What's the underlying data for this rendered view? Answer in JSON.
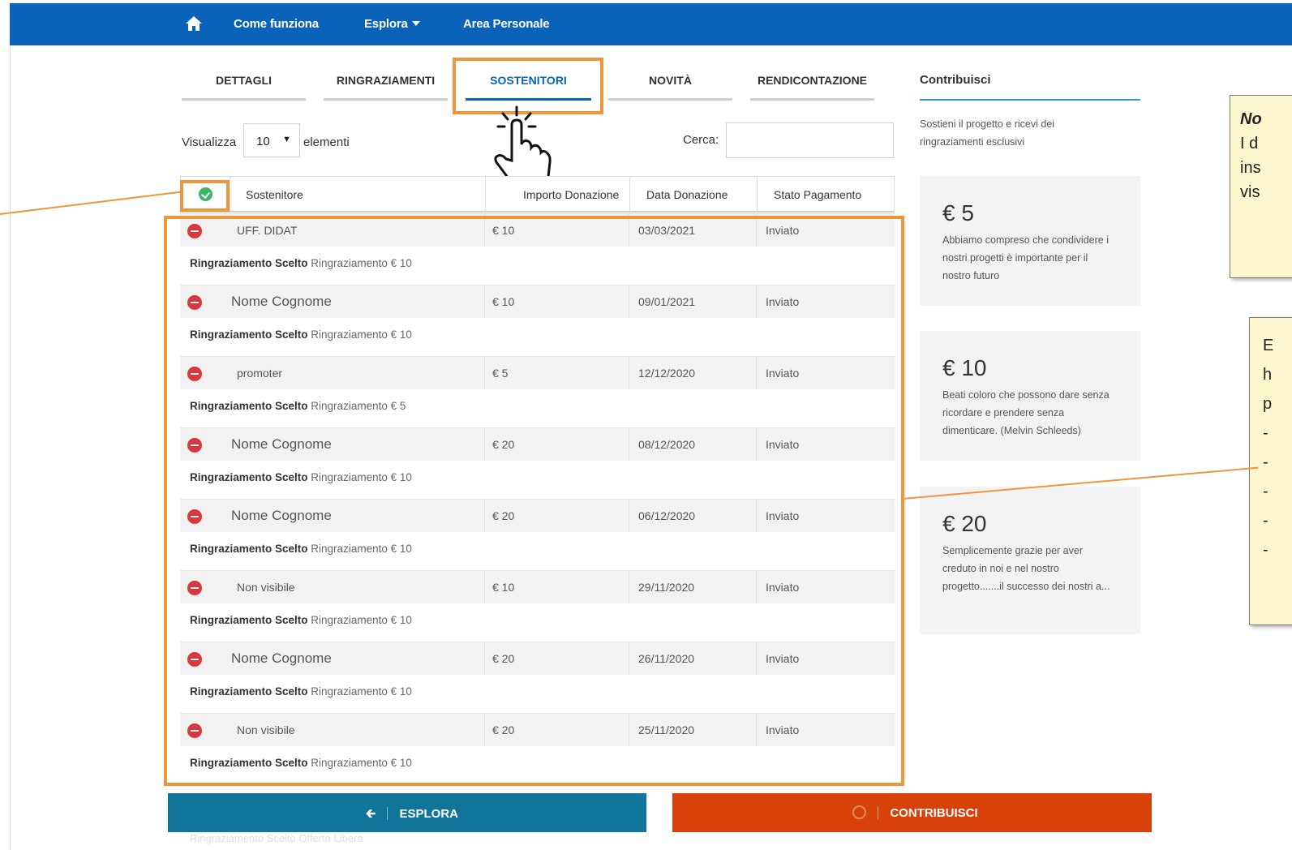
{
  "nav": {
    "items": [
      "Come funziona",
      "Esplora",
      "Area Personale"
    ]
  },
  "tabs": [
    "DETTAGLI",
    "RINGRAZIAMENTI",
    "SOSTENITORI",
    "NOVITÀ",
    "RENDICONTAZIONE"
  ],
  "active_tab": "SOSTENITORI",
  "sidebar": {
    "title": "Contribuisci",
    "subtitle": "Sostieni il progetto e ricevi dei ringraziamenti esclusivi",
    "rewards": [
      {
        "amount": "€ 5",
        "text": "Abbiamo compreso che condividere i nostri progetti è importante per il nostro futuro"
      },
      {
        "amount": "€ 10",
        "text": "Beati coloro che possono dare senza ricordare e prendere senza dimenticare. (Melvin Schleeds)"
      },
      {
        "amount": "€ 20",
        "text": "Semplicemente grazie per aver creduto in noi e nel nostro progetto.......il successo dei nostri a..."
      }
    ]
  },
  "controls": {
    "show_label": "Visualizza",
    "show_value": "10",
    "show_after": "elementi",
    "search_label": "Cerca:"
  },
  "table": {
    "headers": [
      "Sostenitore",
      "Importo Donazione",
      "Data Donazione",
      "Stato Pagamento"
    ],
    "reward_label": "Ringraziamento Scelto",
    "rows": [
      {
        "name": "UFF. DIDAT",
        "amount": "€ 10",
        "date": "03/03/2021",
        "status": "Inviato",
        "reward": "Ringraziamento € 10",
        "big": false
      },
      {
        "name": "Nome Cognome",
        "amount": "€ 10",
        "date": "09/01/2021",
        "status": "Inviato",
        "reward": "Ringraziamento € 10",
        "big": true
      },
      {
        "name": "promoter",
        "amount": "€ 5",
        "date": "12/12/2020",
        "status": "Inviato",
        "reward": "Ringraziamento € 5",
        "big": false
      },
      {
        "name": "Nome Cognome",
        "amount": "€ 20",
        "date": "08/12/2020",
        "status": "Inviato",
        "reward": "Ringraziamento € 10",
        "big": true
      },
      {
        "name": "Nome Cognome",
        "amount": "€ 20",
        "date": "06/12/2020",
        "status": "Inviato",
        "reward": "Ringraziamento € 10",
        "big": true
      },
      {
        "name": "Non visibile",
        "amount": "€ 10",
        "date": "29/11/2020",
        "status": "Inviato",
        "reward": "Ringraziamento € 10",
        "big": false
      },
      {
        "name": "Nome Cognome",
        "amount": "€ 20",
        "date": "26/11/2020",
        "status": "Inviato",
        "reward": "Ringraziamento € 10",
        "big": true
      },
      {
        "name": "Non visibile",
        "amount": "€ 20",
        "date": "25/11/2020",
        "status": "Inviato",
        "reward": "Ringraziamento € 10",
        "big": false
      }
    ]
  },
  "buttons": {
    "esplora": "ESPLORA",
    "contribuisci": "CONTRIBUISCI"
  },
  "notes": {
    "note1_lines": [
      "No",
      "I d",
      "ins",
      "vis"
    ],
    "note2_lines": [
      "E",
      "h",
      "p",
      "-",
      "-",
      "-",
      "-",
      "-"
    ]
  },
  "colors": {
    "nav": "#0a63b8",
    "highlight": "#f0963a",
    "esplora": "#11759a",
    "contribuisci": "#d9410b"
  }
}
